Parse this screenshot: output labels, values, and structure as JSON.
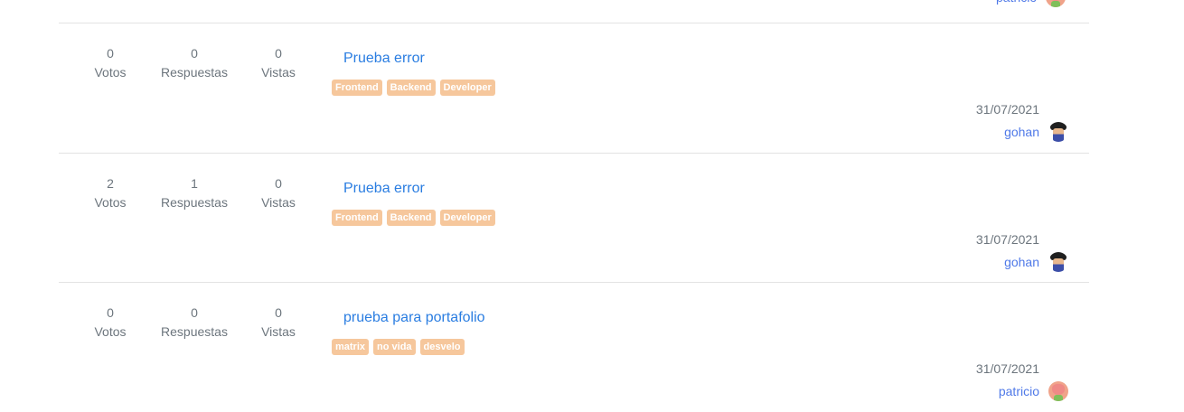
{
  "top_author": {
    "name": "patricio",
    "avatar_icon": "patricio-avatar-icon"
  },
  "questions": [
    {
      "votes": "0",
      "votes_label": "Votos",
      "answers": "0",
      "answers_label": "Respuestas",
      "views": "0",
      "views_label": "Vistas",
      "title": "Prueba error",
      "tags": [
        "Frontend",
        "Backend",
        "Developer"
      ],
      "date": "31/07/2021",
      "author": "gohan"
    },
    {
      "votes": "2",
      "votes_label": "Votos",
      "answers": "1",
      "answers_label": "Respuestas",
      "views": "0",
      "views_label": "Vistas",
      "title": "Prueba error",
      "tags": [
        "Frontend",
        "Backend",
        "Developer"
      ],
      "date": "31/07/2021",
      "author": "gohan"
    },
    {
      "votes": "0",
      "votes_label": "Votos",
      "answers": "0",
      "answers_label": "Respuestas",
      "views": "0",
      "views_label": "Vistas",
      "title": "prueba para portafolio",
      "tags": [
        "matrix",
        "no vida",
        "desvelo"
      ],
      "date": "31/07/2021",
      "author": "patricio"
    }
  ],
  "colors": {
    "link": "#2a7de1",
    "author": "#4f79e8",
    "tag_bg": "#f6c79c",
    "divider": "#e3e3e3"
  }
}
